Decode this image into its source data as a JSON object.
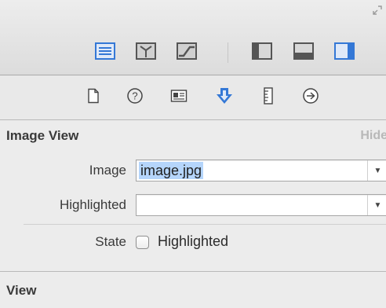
{
  "toolbar": {
    "corner_icon": "resize-corner-icon",
    "editor_buttons": [
      {
        "name": "standard-editor-icon",
        "active": true
      },
      {
        "name": "assistant-editor-icon",
        "active": false
      },
      {
        "name": "version-editor-icon",
        "active": false
      }
    ],
    "view_buttons": [
      {
        "name": "navigator-toggle-icon",
        "active": false
      },
      {
        "name": "debug-area-toggle-icon",
        "active": false
      },
      {
        "name": "utilities-toggle-icon",
        "active": true
      }
    ],
    "accent": "#3478d6"
  },
  "inspector_tabs": [
    {
      "name": "file-inspector-icon",
      "active": false
    },
    {
      "name": "quick-help-icon",
      "active": false
    },
    {
      "name": "identity-inspector-icon",
      "active": false
    },
    {
      "name": "attributes-inspector-icon",
      "active": true
    },
    {
      "name": "size-inspector-icon",
      "active": false
    },
    {
      "name": "connections-inspector-icon",
      "active": false
    }
  ],
  "image_view": {
    "title": "Image View",
    "hide_label": "Hide",
    "image_label": "Image",
    "image_value": "image.jpg",
    "highlighted_label": "Highlighted",
    "highlighted_value": "",
    "state_label": "State",
    "state_checkbox_label": "Highlighted",
    "state_checked": false
  },
  "view_section": {
    "title": "View"
  }
}
